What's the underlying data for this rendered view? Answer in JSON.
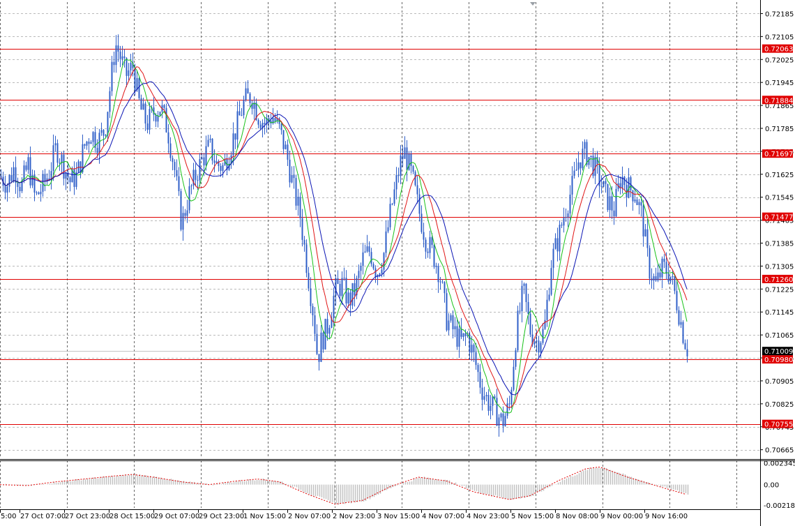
{
  "chart_data": {
    "type": "candlestick",
    "background": "#ffffff",
    "colors": {
      "candles": "#2f5fc8",
      "ma_fast": "#19c219",
      "ma_mid": "#e01414",
      "ma_slow": "#0a14b4",
      "levels": "#e00000",
      "osc_hist": "#c0c0c0",
      "osc_signal": "#e00000",
      "grid": "#000000"
    },
    "price_axis": {
      "ylim": [
        0.70635,
        0.72225
      ],
      "ticks": [
        "0.72185",
        "0.72105",
        "0.72025",
        "0.71945",
        "0.71865",
        "0.71785",
        "0.71705",
        "0.71625",
        "0.71545",
        "0.71465",
        "0.71385",
        "0.71305",
        "0.71225",
        "0.71145",
        "0.71065",
        "0.70985",
        "0.70905",
        "0.70825",
        "0.70745",
        "0.70665"
      ]
    },
    "time_axis": {
      "labels": [
        "5:00",
        "27 Oct 07:00",
        "27 Oct 23:00",
        "28 Oct 15:00",
        "29 Oct 07:00",
        "29 Oct 23:00",
        "1 Nov 15:00",
        "2 Nov 07:00",
        "2 Nov 23:00",
        "3 Nov 15:00",
        "4 Nov 07:00",
        "4 Nov 23:00",
        "5 Nov 15:00",
        "8 Nov 08:00",
        "9 Nov 00:00",
        "9 Nov 16:00"
      ]
    },
    "current_price": "0.71009",
    "levels": [
      "0.72063",
      "0.71884",
      "0.71697",
      "0.71477",
      "0.71260",
      "0.70980",
      "0.70755"
    ],
    "price_keypoints": [
      [
        0,
        0.7162
      ],
      [
        10,
        0.7159
      ],
      [
        20,
        0.7165
      ],
      [
        30,
        0.7158
      ],
      [
        40,
        0.7166
      ],
      [
        50,
        0.7154
      ],
      [
        60,
        0.7158
      ],
      [
        70,
        0.7163
      ],
      [
        80,
        0.7172
      ],
      [
        90,
        0.7166
      ],
      [
        100,
        0.716
      ],
      [
        110,
        0.7162
      ],
      [
        120,
        0.7172
      ],
      [
        130,
        0.7177
      ],
      [
        140,
        0.7174
      ],
      [
        150,
        0.7178
      ],
      [
        160,
        0.7198
      ],
      [
        165,
        0.7208
      ],
      [
        170,
        0.7205
      ],
      [
        180,
        0.7197
      ],
      [
        190,
        0.72
      ],
      [
        200,
        0.7186
      ],
      [
        210,
        0.718
      ],
      [
        220,
        0.7184
      ],
      [
        230,
        0.7186
      ],
      [
        240,
        0.7178
      ],
      [
        250,
        0.7164
      ],
      [
        260,
        0.7145
      ],
      [
        270,
        0.7155
      ],
      [
        280,
        0.7162
      ],
      [
        290,
        0.7168
      ],
      [
        300,
        0.7172
      ],
      [
        310,
        0.7166
      ],
      [
        320,
        0.7165
      ],
      [
        330,
        0.7172
      ],
      [
        340,
        0.718
      ],
      [
        350,
        0.7188
      ],
      [
        360,
        0.719
      ],
      [
        370,
        0.7183
      ],
      [
        380,
        0.718
      ],
      [
        390,
        0.7183
      ],
      [
        400,
        0.7178
      ],
      [
        410,
        0.717
      ],
      [
        420,
        0.7158
      ],
      [
        430,
        0.7148
      ],
      [
        440,
        0.713
      ],
      [
        450,
        0.7112
      ],
      [
        455,
        0.7098
      ],
      [
        460,
        0.7104
      ],
      [
        470,
        0.711
      ],
      [
        480,
        0.7122
      ],
      [
        490,
        0.7124
      ],
      [
        500,
        0.7118
      ],
      [
        510,
        0.7123
      ],
      [
        520,
        0.7133
      ],
      [
        530,
        0.7136
      ],
      [
        540,
        0.7128
      ],
      [
        550,
        0.7135
      ],
      [
        560,
        0.715
      ],
      [
        570,
        0.7162
      ],
      [
        575,
        0.7168
      ],
      [
        580,
        0.717
      ],
      [
        590,
        0.7162
      ],
      [
        600,
        0.715
      ],
      [
        610,
        0.714
      ],
      [
        620,
        0.7135
      ],
      [
        630,
        0.7128
      ],
      [
        640,
        0.7112
      ],
      [
        650,
        0.7108
      ],
      [
        660,
        0.7104
      ],
      [
        670,
        0.7106
      ],
      [
        680,
        0.7098
      ],
      [
        690,
        0.7088
      ],
      [
        700,
        0.7083
      ],
      [
        710,
        0.708
      ],
      [
        720,
        0.7076
      ],
      [
        730,
        0.7082
      ],
      [
        740,
        0.7108
      ],
      [
        750,
        0.7122
      ],
      [
        760,
        0.7108
      ],
      [
        770,
        0.7104
      ],
      [
        780,
        0.7108
      ],
      [
        790,
        0.7132
      ],
      [
        800,
        0.714
      ],
      [
        810,
        0.715
      ],
      [
        820,
        0.7158
      ],
      [
        830,
        0.7168
      ],
      [
        840,
        0.717
      ],
      [
        850,
        0.7166
      ],
      [
        860,
        0.716
      ],
      [
        870,
        0.7154
      ],
      [
        880,
        0.715
      ],
      [
        890,
        0.7162
      ],
      [
        900,
        0.7158
      ],
      [
        910,
        0.7156
      ],
      [
        920,
        0.7148
      ],
      [
        930,
        0.713
      ],
      [
        940,
        0.7124
      ],
      [
        950,
        0.713
      ],
      [
        960,
        0.7128
      ],
      [
        970,
        0.7118
      ],
      [
        980,
        0.7106
      ],
      [
        986,
        0.7101
      ]
    ],
    "oscillator": {
      "ticks": [
        "0.002345",
        "0.00",
        "-0.002184"
      ],
      "ylim": [
        -0.0025,
        0.0026
      ],
      "signal_keypoints": [
        [
          0,
          0.0
        ],
        [
          40,
          -0.0001
        ],
        [
          80,
          0.0003
        ],
        [
          120,
          0.0006
        ],
        [
          160,
          0.0009
        ],
        [
          190,
          0.0011
        ],
        [
          220,
          0.0008
        ],
        [
          260,
          0.0003
        ],
        [
          300,
          0.0
        ],
        [
          340,
          0.0004
        ],
        [
          370,
          0.0006
        ],
        [
          400,
          0.0003
        ],
        [
          440,
          -0.001
        ],
        [
          480,
          -0.0021
        ],
        [
          520,
          -0.0017
        ],
        [
          560,
          -0.0002
        ],
        [
          600,
          0.0008
        ],
        [
          640,
          0.0004
        ],
        [
          680,
          -0.0008
        ],
        [
          730,
          -0.0016
        ],
        [
          760,
          -0.0012
        ],
        [
          800,
          0.0004
        ],
        [
          840,
          0.0017
        ],
        [
          860,
          0.0019
        ],
        [
          900,
          0.0008
        ],
        [
          940,
          -0.0001
        ],
        [
          986,
          -0.0011
        ]
      ]
    }
  }
}
